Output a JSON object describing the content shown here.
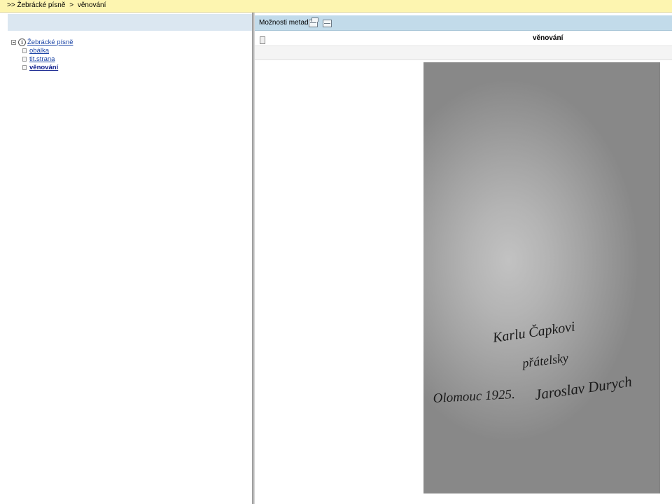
{
  "breadcrumb": {
    "prefix": ">>",
    "items": [
      "Žebrácké písně",
      "věnování"
    ],
    "separator": ">"
  },
  "tree": {
    "root": {
      "label": "Žebrácké písně",
      "icon": "info-icon"
    },
    "children": [
      {
        "label": "obálka",
        "current": false
      },
      {
        "label": "tit.strana",
        "current": false
      },
      {
        "label": "věnování",
        "current": true
      }
    ]
  },
  "metadata": {
    "label": "Možnosti metadat:",
    "buttons": [
      {
        "icon": "metadata-window-icon"
      },
      {
        "icon": "metadata-panel-icon"
      }
    ]
  },
  "page": {
    "title": "věnování",
    "handwriting": {
      "line1": "Karlu Čapkovi",
      "line2": "přátelsky",
      "line3_left": "Olomouc 1925.",
      "line3_right": "Jaroslav Durych"
    }
  },
  "colors": {
    "breadcrumb_bg": "#fdf5b0",
    "header_bg": "#dbe7f1",
    "metadata_bg": "#c2dbea",
    "link": "#1a44a6"
  }
}
